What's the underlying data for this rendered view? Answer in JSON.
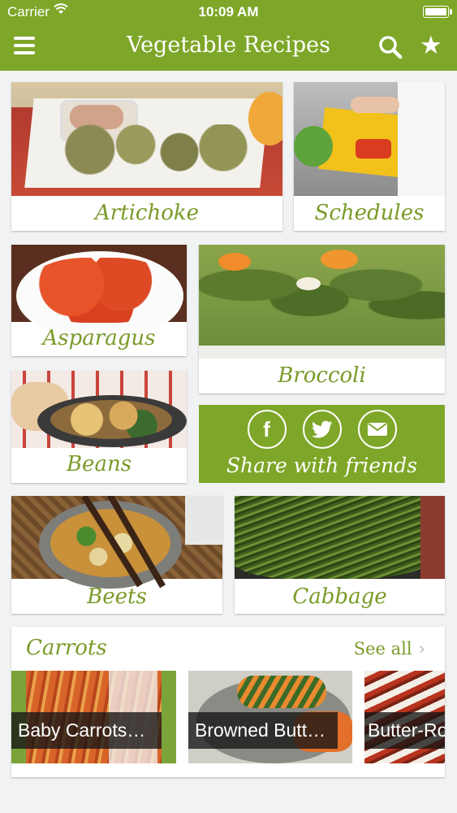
{
  "status_bar": {
    "carrier": "Carrier",
    "time": "10:09 AM"
  },
  "nav": {
    "title": "Vegetable Recipes",
    "menu_icon": "hamburger-menu-icon",
    "search_icon": "search-icon",
    "favorites_icon": "star-icon"
  },
  "categories": {
    "artichoke": "Artichoke",
    "schedules": "Schedules",
    "asparagus": "Asparagus",
    "broccoli": "Broccoli",
    "beans": "Beans",
    "beets": "Beets",
    "cabbage": "Cabbage"
  },
  "share": {
    "label": "Share with friends",
    "icons": [
      "facebook-icon",
      "twitter-icon",
      "email-icon"
    ]
  },
  "carrots": {
    "title": "Carrots",
    "see_all": "See all",
    "recipes": [
      "Baby Carrots…",
      "Browned Butt…",
      "Butter-Ro"
    ]
  },
  "theme": {
    "accent": "#7ea628",
    "label_green": "#7a9b2a"
  }
}
